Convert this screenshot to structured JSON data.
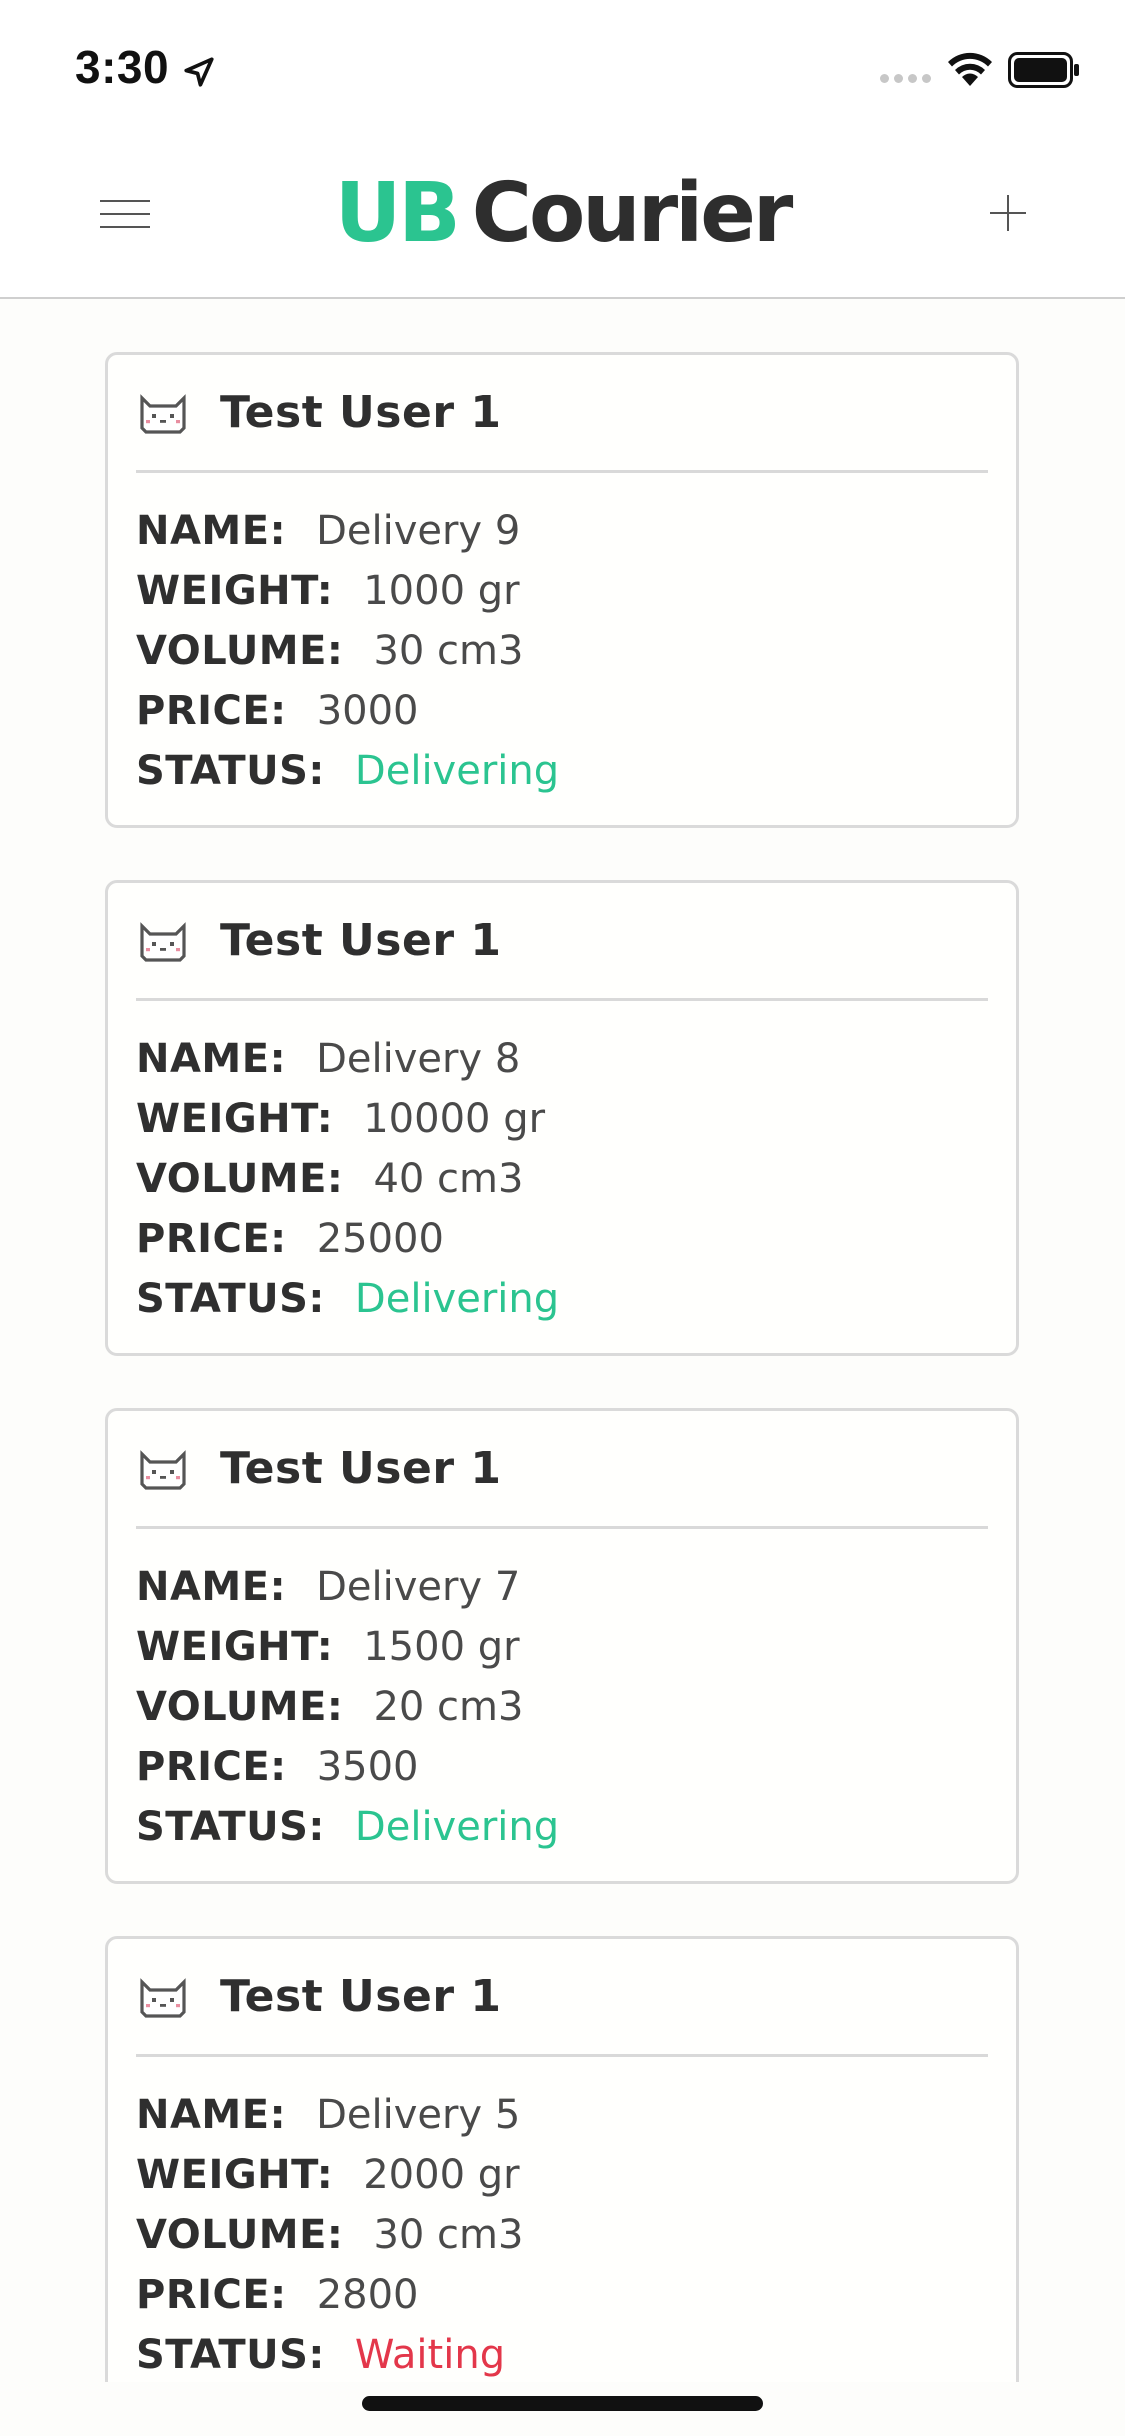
{
  "status_bar": {
    "time": "3:30"
  },
  "header": {
    "brand_primary": "UB",
    "brand_secondary": "Courier"
  },
  "colors": {
    "brand_green": "#2bc490",
    "status_delivering": "#2bc490",
    "status_waiting": "#e3374a"
  },
  "labels": {
    "name": "NAME:",
    "weight": "WEIGHT:",
    "volume": "VOLUME:",
    "price": "PRICE:",
    "status": "STATUS:"
  },
  "deliveries": [
    {
      "user": "Test User 1",
      "avatar_icon": "pixel-cat-icon",
      "name": "Delivery 9",
      "weight": "1000 gr",
      "volume": "30 cm3",
      "price": "3000",
      "status": "Delivering"
    },
    {
      "user": "Test User 1",
      "avatar_icon": "pixel-cat-icon",
      "name": "Delivery 8",
      "weight": "10000 gr",
      "volume": "40 cm3",
      "price": "25000",
      "status": "Delivering"
    },
    {
      "user": "Test User 1",
      "avatar_icon": "pixel-cat-icon",
      "name": "Delivery 7",
      "weight": "1500 gr",
      "volume": "20 cm3",
      "price": "3500",
      "status": "Delivering"
    },
    {
      "user": "Test User 1",
      "avatar_icon": "pixel-cat-icon",
      "name": "Delivery 5",
      "weight": "2000 gr",
      "volume": "30 cm3",
      "price": "2800",
      "status": "Waiting"
    }
  ]
}
